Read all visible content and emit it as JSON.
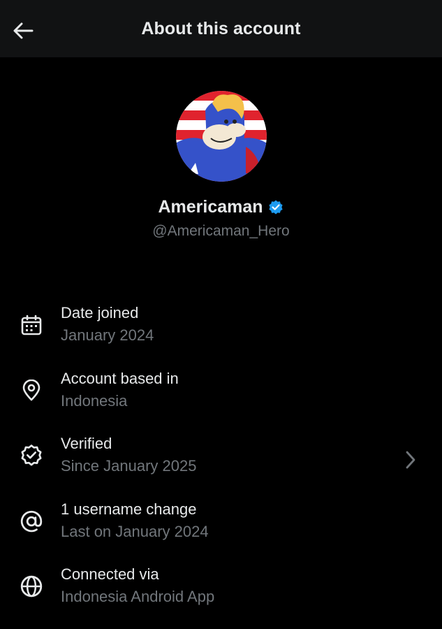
{
  "header": {
    "title": "About this account",
    "back_icon": "arrow-left-icon"
  },
  "profile": {
    "display_name": "Americaman",
    "handle": "@Americaman_Hero",
    "verified_badge_color": "#1d9bf0"
  },
  "rows": [
    {
      "icon": "calendar-icon",
      "label": "Date joined",
      "value": "January 2024"
    },
    {
      "icon": "location-pin-icon",
      "label": "Account based in",
      "value": "Indonesia"
    },
    {
      "icon": "verified-check-icon",
      "label": "Verified",
      "value": "Since January 2025"
    },
    {
      "icon": "at-sign-icon",
      "label": "1 username change",
      "value": "Last on January 2024"
    },
    {
      "icon": "globe-icon",
      "label": "Connected via",
      "value": "Indonesia Android App"
    }
  ],
  "colors": {
    "background": "#000000",
    "header_bg": "#111213",
    "text_primary": "#e7e9ea",
    "text_secondary": "#71767b",
    "accent": "#1d9bf0"
  }
}
